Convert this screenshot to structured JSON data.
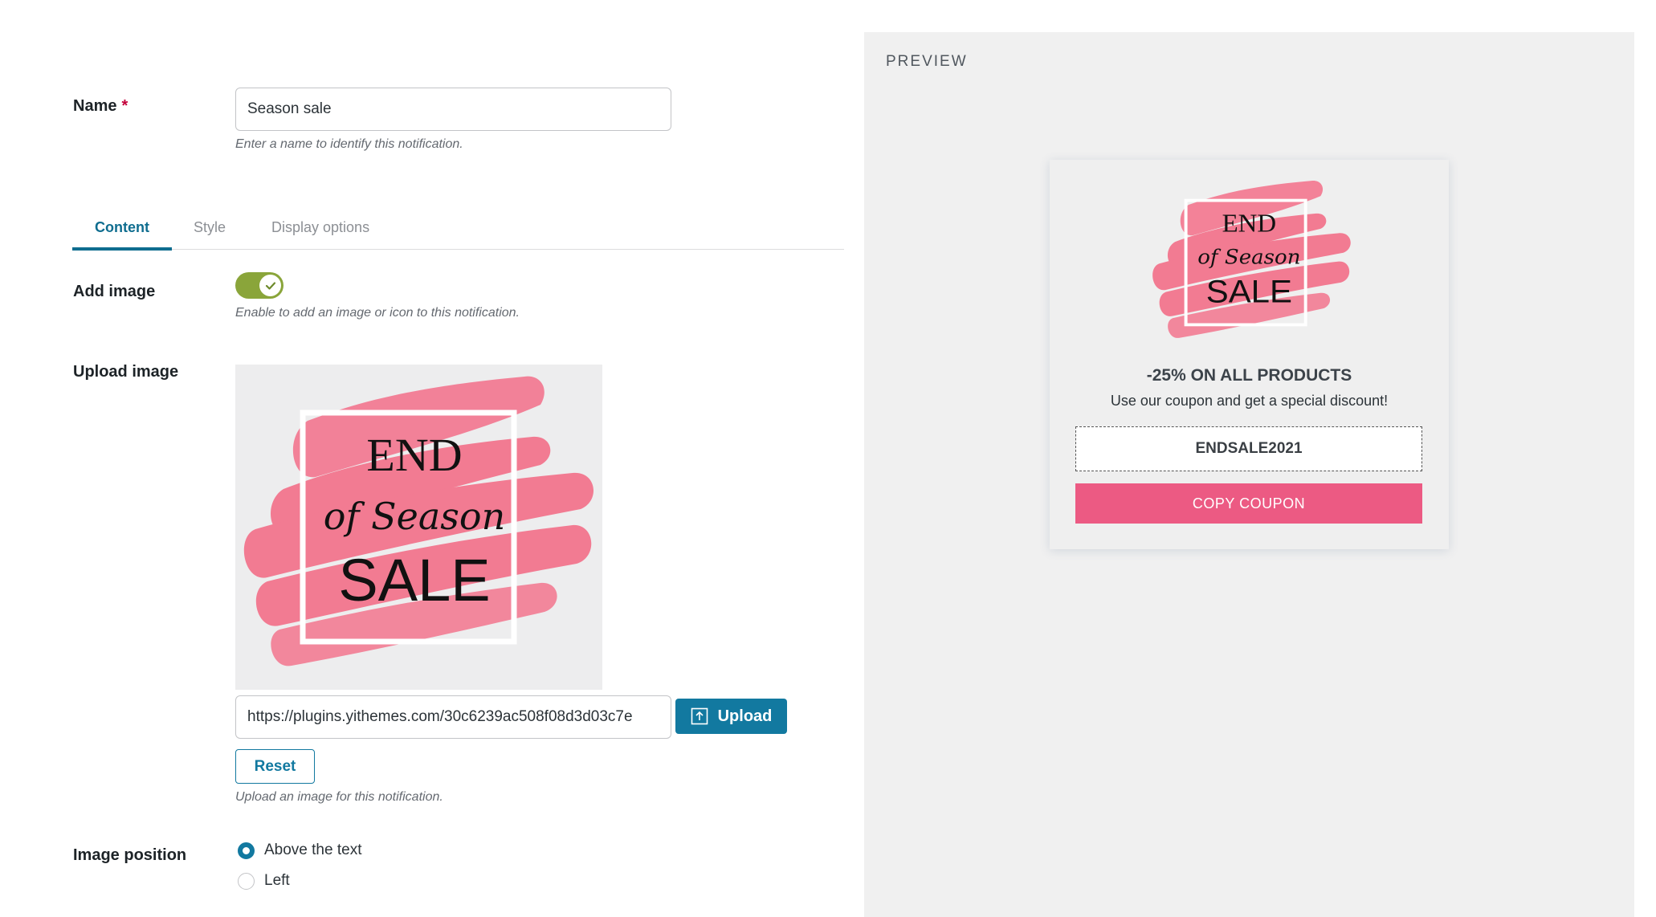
{
  "form": {
    "name_label": "Name",
    "required_mark": "*",
    "name_value": "Season sale",
    "name_help": "Enter a name to identify this notification.",
    "tabs": [
      {
        "label": "Content",
        "active": true
      },
      {
        "label": "Style",
        "active": false
      },
      {
        "label": "Display options",
        "active": false
      }
    ],
    "add_image_label": "Add image",
    "add_image_enabled": true,
    "add_image_help": "Enable to add an image or icon to this notification.",
    "upload_image_label": "Upload image",
    "image_url": "https://plugins.yithemes.com/30c6239ac508f08d3d03c7e",
    "upload_button": "Upload",
    "reset_button": "Reset",
    "upload_help": "Upload an image for this notification.",
    "image_position_label": "Image position",
    "image_position_options": [
      {
        "label": "Above the text",
        "selected": true
      },
      {
        "label": "Left",
        "selected": false
      }
    ]
  },
  "sale_image": {
    "line1": "END",
    "line2": "of Season",
    "line3": "SALE",
    "brush_color": "#f27b92"
  },
  "preview": {
    "title": "PREVIEW",
    "headline": "-25% ON ALL PRODUCTS",
    "description": "Use our coupon and get a special discount!",
    "coupon_code": "ENDSALE2021",
    "copy_button": "COPY COUPON",
    "button_color": "#ec5a83"
  },
  "colors": {
    "accent": "#1279a0",
    "toggle_on": "#8aa53a",
    "required": "#c4003a"
  }
}
